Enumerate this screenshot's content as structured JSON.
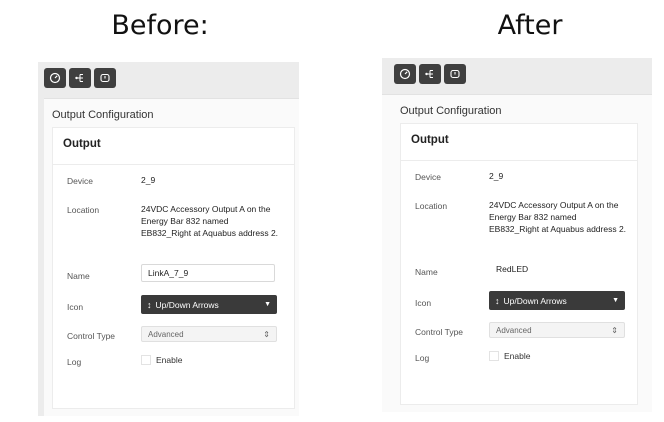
{
  "panels": [
    {
      "heading": "Before:",
      "section_title": "Output Configuration",
      "subhead": "Output",
      "fields": {
        "device_label": "Device",
        "device_value": "2_9",
        "location_label": "Location",
        "location_value": "24VDC Accessory Output A on the Energy Bar 832 named EB832_Right at Aquabus address 2.",
        "name_label": "Name",
        "name_value": "LinkA_7_9",
        "icon_label": "Icon",
        "icon_value": "Up/Down Arrows",
        "control_type_label": "Control Type",
        "control_type_value": "Advanced",
        "log_label": "Log",
        "log_value": "Enable"
      }
    },
    {
      "heading": "After",
      "section_title": "Output Configuration",
      "subhead": "Output",
      "fields": {
        "device_label": "Device",
        "device_value": "2_9",
        "location_label": "Location",
        "location_value": "24VDC Accessory Output A on the Energy Bar 832 named EB832_Right at Aquabus address 2.",
        "name_label": "Name",
        "name_value": "RedLED",
        "icon_label": "Icon",
        "icon_value": "Up/Down Arrows",
        "control_type_label": "Control Type",
        "control_type_value": "Advanced",
        "log_label": "Log",
        "log_value": "Enable"
      }
    }
  ],
  "toolbar_icons": [
    "gauge-icon",
    "network-tree-icon",
    "power-icon"
  ]
}
